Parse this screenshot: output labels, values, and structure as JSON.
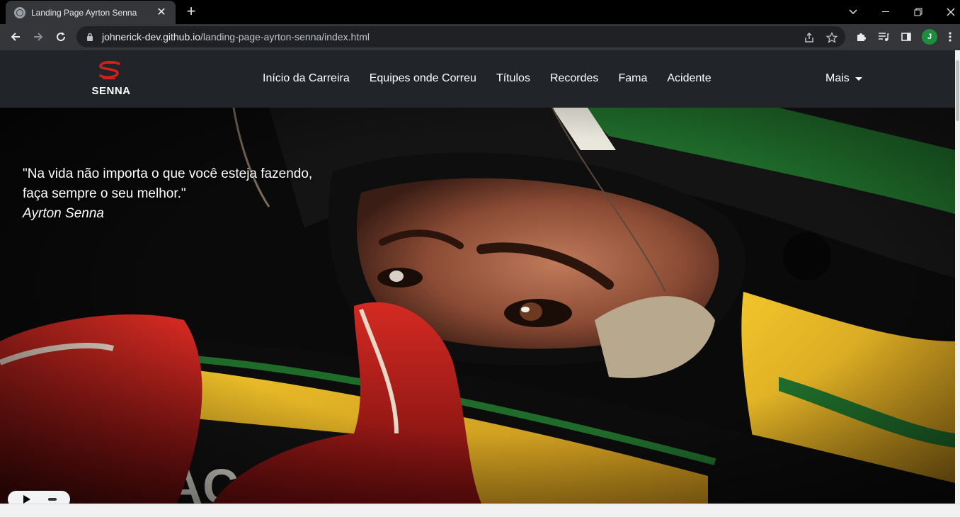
{
  "browser": {
    "tab_title": "Landing Page Ayrton Senna",
    "url_host": "johnerick-dev.github.io",
    "url_path": "/landing-page-ayrton-senna/index.html",
    "profile_initial": "J"
  },
  "site": {
    "logo_text": "SENNA",
    "nav_links": [
      "Início da Carreira",
      "Equipes onde Correu",
      "Títulos",
      "Recordes",
      "Fama",
      "Acidente"
    ],
    "more_label": "Mais"
  },
  "hero": {
    "quote_line1": "\"Na vida não importa o que você esteja fazendo,",
    "quote_line2": "faça sempre o seu melhor.\"",
    "quote_author": "Ayrton Senna"
  },
  "colors": {
    "navbar_bg": "#212529",
    "logo_red": "#d0211c",
    "helmet_yellow": "#e8b21a",
    "helmet_green": "#1f6b2a",
    "glove_red": "#b5141a"
  }
}
